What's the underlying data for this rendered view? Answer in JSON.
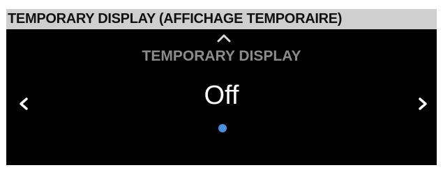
{
  "header": {
    "title": "TEMPORARY DISPLAY (AFFICHAGE TEMPORAIRE)"
  },
  "screen": {
    "label": "TEMPORARY DISPLAY",
    "value": "Off",
    "icons": {
      "up": "chevron-up-icon",
      "left": "chevron-left-icon",
      "right": "chevron-right-icon",
      "page_indicator": "page-indicator-dot"
    },
    "colors": {
      "background": "#000000",
      "label": "#8c8c8c",
      "value": "#ffffff",
      "dot": "#4a8fe0"
    }
  }
}
